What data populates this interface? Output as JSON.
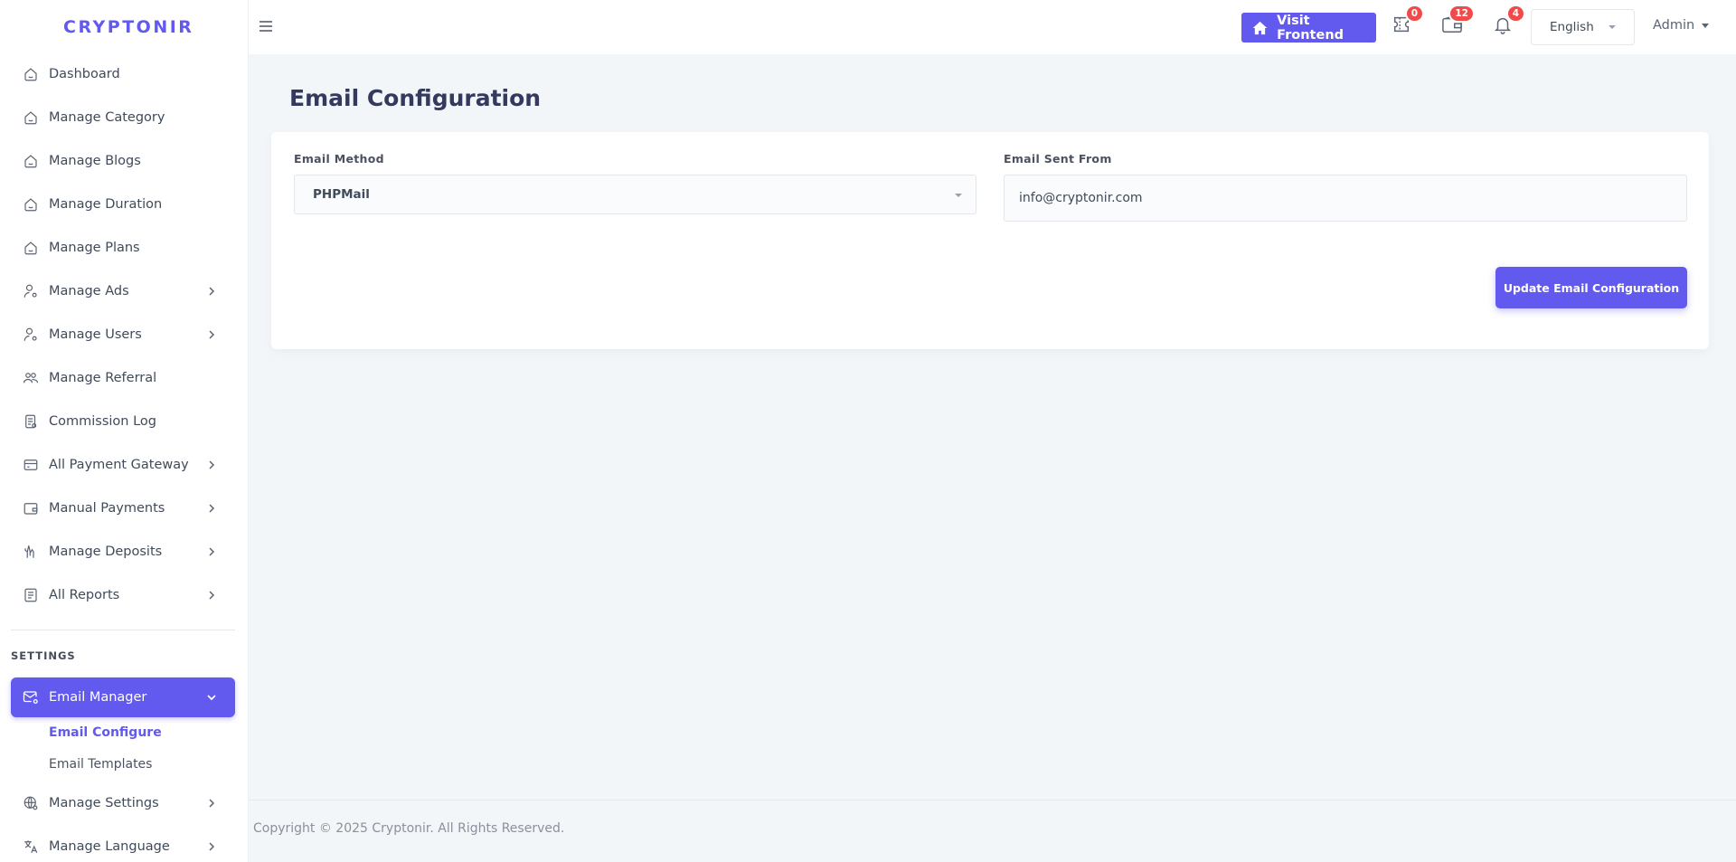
{
  "brand": "CRYPTONIR",
  "sidebar": {
    "items": [
      {
        "label": "Dashboard",
        "icon": "home-icon",
        "has_chevron": false
      },
      {
        "label": "Manage Category",
        "icon": "home-icon",
        "has_chevron": false
      },
      {
        "label": "Manage Blogs",
        "icon": "home-icon",
        "has_chevron": false
      },
      {
        "label": "Manage Duration",
        "icon": "home-icon",
        "has_chevron": false
      },
      {
        "label": "Manage Plans",
        "icon": "home-icon",
        "has_chevron": false
      },
      {
        "label": "Manage Ads",
        "icon": "user-gear-icon",
        "has_chevron": true
      },
      {
        "label": "Manage Users",
        "icon": "user-gear-icon",
        "has_chevron": true
      },
      {
        "label": "Manage Referral",
        "icon": "users-icon",
        "has_chevron": false
      },
      {
        "label": "Commission Log",
        "icon": "document-icon",
        "has_chevron": false
      },
      {
        "label": "All Payment Gateway",
        "icon": "card-icon",
        "has_chevron": true
      },
      {
        "label": "Manual Payments",
        "icon": "wallet-icon",
        "has_chevron": true
      },
      {
        "label": "Manage Deposits",
        "icon": "hand-icon",
        "has_chevron": true
      },
      {
        "label": "All Reports",
        "icon": "report-icon",
        "has_chevron": true
      }
    ],
    "settings_heading": "SETTINGS",
    "email_manager": {
      "label": "Email Manager",
      "icon": "mail-gear-icon"
    },
    "email_sub": [
      {
        "label": "Email Configure",
        "current": true
      },
      {
        "label": "Email Templates",
        "current": false
      }
    ],
    "settings_items": [
      {
        "label": "Manage Settings",
        "icon": "globe-gear-icon"
      },
      {
        "label": "Manage Language",
        "icon": "translate-icon"
      }
    ]
  },
  "topbar": {
    "visit_label": "Visit Frontend",
    "ticket_count": "0",
    "wallet_count": "12",
    "notification_count": "4",
    "language": "English",
    "user": "Admin"
  },
  "main": {
    "title": "Email Configuration",
    "email_method_label": "Email Method",
    "email_method_value": "PHPMail",
    "email_from_label": "Email Sent From",
    "email_from_value": "info@cryptonir.com",
    "update_label": "Update Email Configuration"
  },
  "footer": {
    "copyright": "Copyright © 2025 Cryptonir. All Rights Reserved."
  },
  "colors": {
    "accent": "#6259ee",
    "badge": "#ef4b4b",
    "background": "#f3f6f9"
  }
}
